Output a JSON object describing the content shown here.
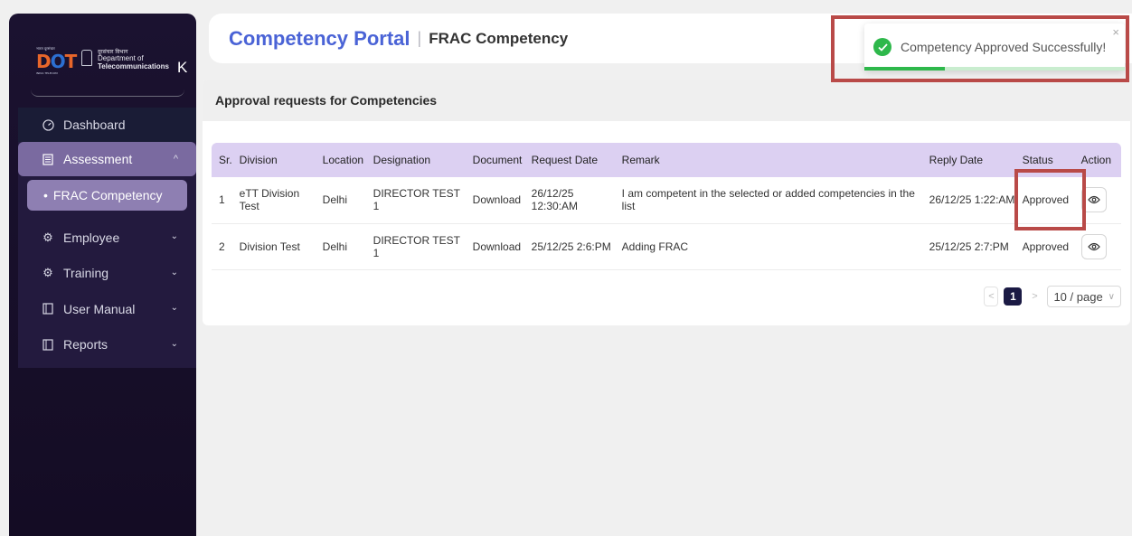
{
  "logo": {
    "hindi_small": "भारत दूरसंचार",
    "brand": "DOT",
    "sub": "INDIA TELECOM",
    "dept_hindi": "दूरसंचार विभाग",
    "dept_line1": "Department of",
    "dept_line2": "Telecommunications",
    "collapse_glyph": "K"
  },
  "sidebar": {
    "dashboard": "Dashboard",
    "assessment": "Assessment",
    "frac": "FRAC Competency",
    "employee": "Employee",
    "training": "Training",
    "user_manual": "User Manual",
    "reports": "Reports"
  },
  "header": {
    "brand": "Competency Portal",
    "separator": "|",
    "subtitle": "FRAC Competency"
  },
  "card": {
    "title": "Approval requests for Competencies"
  },
  "table": {
    "columns": [
      "Sr.",
      "Division",
      "Location",
      "Designation",
      "Document",
      "Request Date",
      "Remark",
      "Reply Date",
      "Status",
      "Action"
    ],
    "rows": [
      {
        "sr": "1",
        "division": "eTT Division Test",
        "location": "Delhi",
        "designation": "DIRECTOR TEST 1",
        "document": "Download",
        "request_date": "26/12/25 12:30:AM",
        "remark": "I am competent in the selected or added competencies in the list",
        "reply_date": "26/12/25 1:22:AM",
        "status": "Approved"
      },
      {
        "sr": "2",
        "division": "Division Test",
        "location": "Delhi",
        "designation": "DIRECTOR TEST 1",
        "document": "Download",
        "request_date": "25/12/25 2:6:PM",
        "remark": "Adding FRAC",
        "reply_date": "25/12/25 2:7:PM",
        "status": "Approved"
      }
    ]
  },
  "pagination": {
    "current": "1",
    "page_size": "10 / page"
  },
  "toast": {
    "message": "Competency Approved Successfully!",
    "close": "×",
    "progress": 0.31
  },
  "colors": {
    "accent": "#4a63d6",
    "success": "#2eb84b",
    "annotation": "#b94a48",
    "table_header": "#dcd0f2"
  }
}
